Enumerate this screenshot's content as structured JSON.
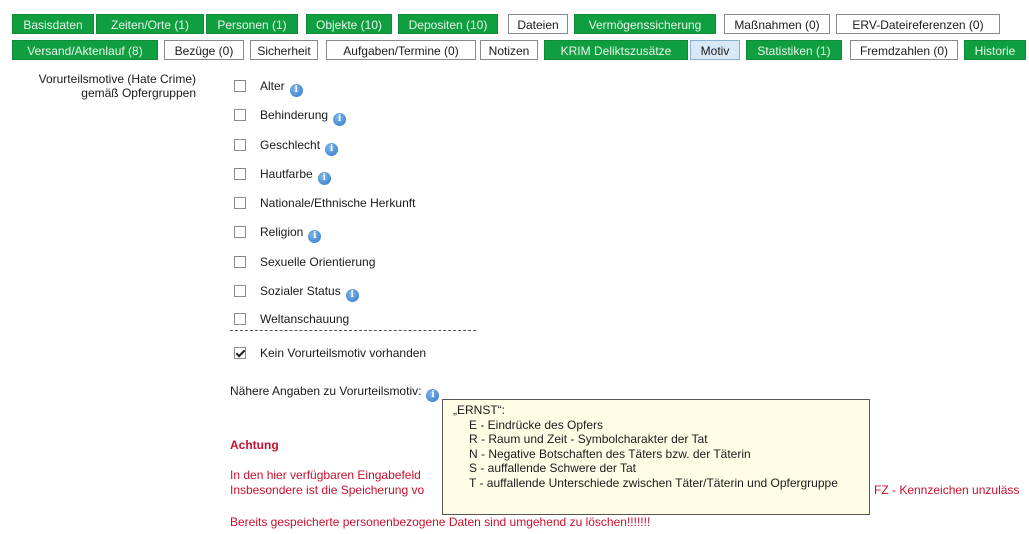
{
  "tabs_row1": [
    {
      "label": "Basisdaten",
      "style": "green"
    },
    {
      "label": "Zeiten/Orte (1)",
      "style": "green"
    },
    {
      "label": "Personen (1)",
      "style": "green"
    },
    {
      "label": "Objekte (10)",
      "style": "green"
    },
    {
      "label": "Depositen (10)",
      "style": "green"
    },
    {
      "label": "Dateien",
      "style": "white"
    },
    {
      "label": "Vermögenssicherung",
      "style": "green"
    },
    {
      "label": "Maßnahmen (0)",
      "style": "white"
    },
    {
      "label": "ERV-Dateireferenzen (0)",
      "style": "white"
    }
  ],
  "tabs_row2": [
    {
      "label": "Versand/Aktenlauf (8)",
      "style": "green"
    },
    {
      "label": "Bezüge (0)",
      "style": "white"
    },
    {
      "label": "Sicherheit",
      "style": "white"
    },
    {
      "label": "Aufgaben/Termine (0)",
      "style": "white"
    },
    {
      "label": "Notizen",
      "style": "white"
    },
    {
      "label": "KRIM Deliktszusätze",
      "style": "green"
    },
    {
      "label": "Motiv",
      "style": "active"
    },
    {
      "label": "Statistiken (1)",
      "style": "green"
    },
    {
      "label": "Fremdzahlen (0)",
      "style": "white"
    },
    {
      "label": "Historie",
      "style": "green"
    }
  ],
  "motive": {
    "group_label": "Vorurteilsmotive (Hate Crime) gemäß Opfergruppen",
    "options": [
      {
        "label": "Alter",
        "checked": false,
        "info": true
      },
      {
        "label": "Behinderung",
        "checked": false,
        "info": true
      },
      {
        "label": "Geschlecht",
        "checked": false,
        "info": true
      },
      {
        "label": "Hautfarbe",
        "checked": false,
        "info": true
      },
      {
        "label": "Nationale/Ethnische Herkunft",
        "checked": false,
        "info": false
      },
      {
        "label": "Religion",
        "checked": false,
        "info": true
      },
      {
        "label": "Sexuelle Orientierung",
        "checked": false,
        "info": false
      },
      {
        "label": "Sozialer Status",
        "checked": false,
        "info": true
      },
      {
        "label": "Weltanschauung",
        "checked": false,
        "info": false
      }
    ],
    "none_option": {
      "label": "Kein Vorurteilsmotiv vorhanden",
      "checked": true
    },
    "details_label": "Nähere Angaben zu Vorurteilsmotiv:",
    "info_glyph": "i"
  },
  "tooltip": {
    "title": "„ERNST“:",
    "lines": [
      "E - Eindrücke des Opfers",
      "R - Raum und Zeit - Symbolcharakter der Tat",
      "N - Negative Botschaften des Täters bzw. der Täterin",
      "S - auffallende Schwere der Tat",
      "T - auffallende Unterschiede zwischen Täter/Täterin und Opfergruppe"
    ]
  },
  "warning": {
    "heading": "Achtung",
    "line1": "In den hier verfügbaren Eingabefeld",
    "line2_start": "Insbesondere ist die Speicherung vo",
    "line2_end": "FZ - Kennzeichen unzuläss",
    "line3": "Bereits gespeicherte personenbezogene Daten sind umgehend zu löschen!!!!!!!"
  },
  "colors": {
    "tab_green": "#0f9f40",
    "tab_active": "#d8e8f6",
    "warning_red": "#c8102e",
    "tooltip_bg": "#fffde6",
    "info_blue": "#2f78c8"
  }
}
